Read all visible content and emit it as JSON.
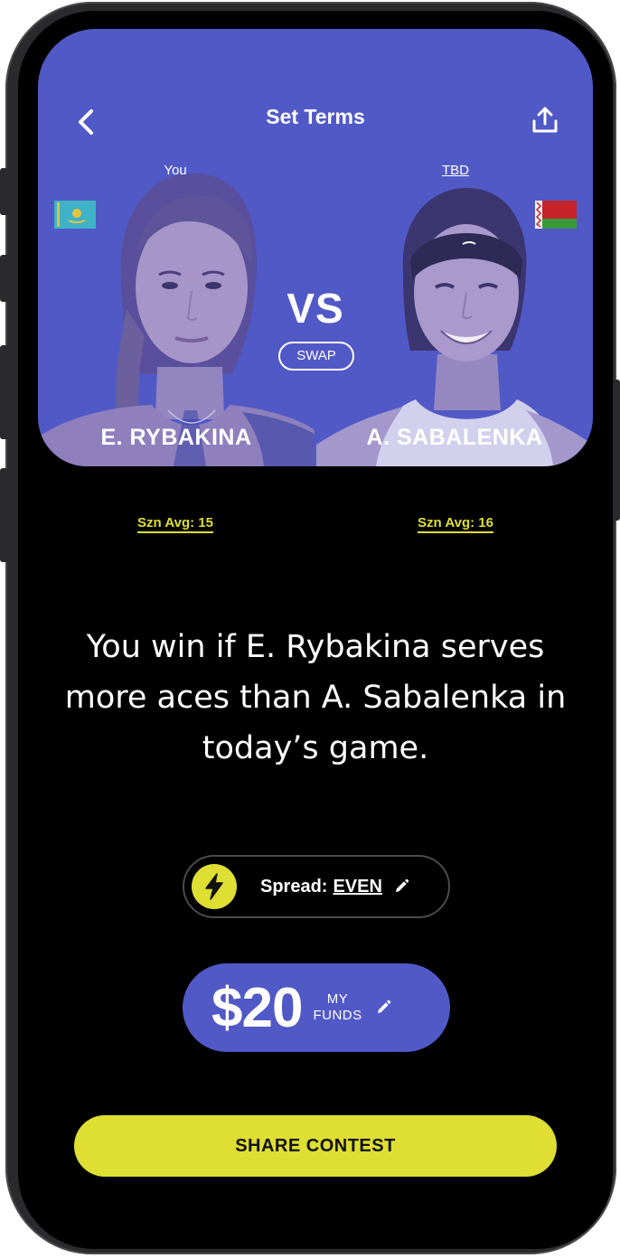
{
  "header": {
    "title": "Set Terms",
    "back_icon": "chevron-left-icon",
    "share_icon": "share-upload-icon"
  },
  "players": {
    "left": {
      "side_label": "You",
      "name": "E. RYBAKINA",
      "flag": "kazakhstan-flag",
      "szn_avg": "Szn Avg: 15"
    },
    "right": {
      "side_label": "TBD",
      "name": "A. SABALENKA",
      "flag": "belarus-flag",
      "szn_avg": "Szn Avg: 16"
    }
  },
  "versus": {
    "label": "VS",
    "swap_label": "SWAP"
  },
  "statement": "You win if E. Rybakina serves more aces than A. Sabalenka in today’s game.",
  "spread": {
    "label": "Spread:",
    "value": "EVEN",
    "icon": "lightning-bolt-icon"
  },
  "funds": {
    "amount": "$20",
    "label_line1": "MY",
    "label_line2": "FUNDS"
  },
  "cta": {
    "label": "SHARE CONTEST"
  },
  "colors": {
    "accent_blue": "#5159c7",
    "accent_yellow": "#dede33",
    "background": "#000000"
  }
}
